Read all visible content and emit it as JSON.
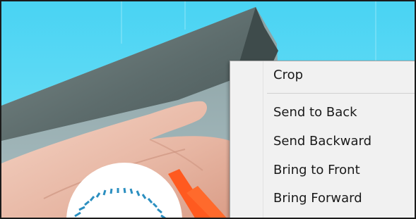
{
  "context_menu": {
    "items": [
      {
        "label": "Crop"
      },
      {
        "label": "Send to Back"
      },
      {
        "label": "Send Backward"
      },
      {
        "label": "Bring to Front"
      },
      {
        "label": "Bring Forward"
      }
    ]
  },
  "colors": {
    "background_sky": "#54d6f2",
    "device_grey": "#5f6e6e",
    "accent_orange": "#ff5a1f",
    "dial_blue": "#2b8fc0",
    "menu_background": "#f1f1f1"
  }
}
